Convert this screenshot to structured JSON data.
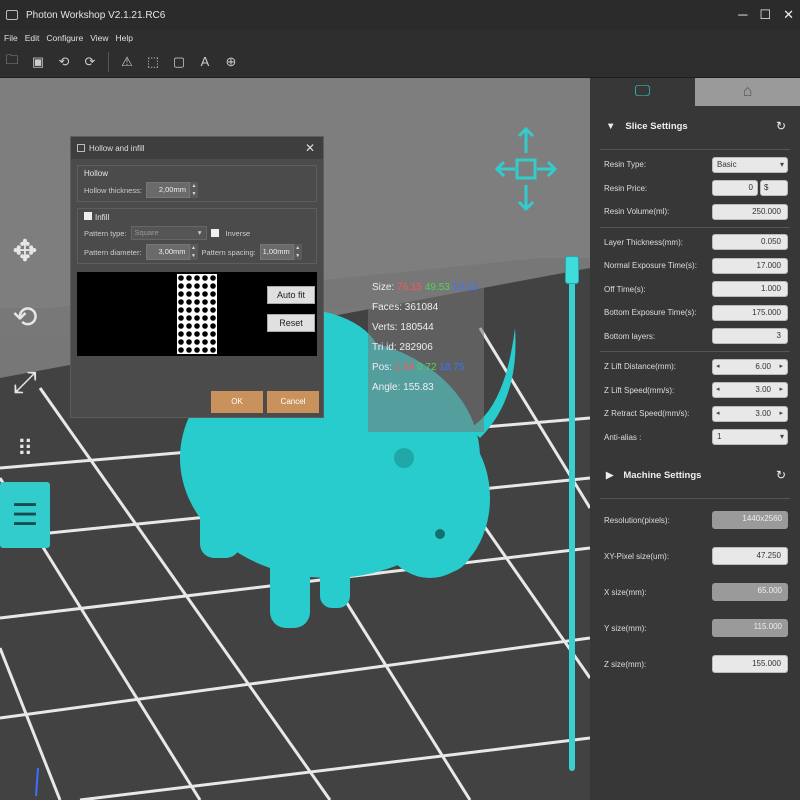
{
  "app": {
    "title": "Photon Workshop V2.1.21.RC6",
    "window_controls": [
      "─",
      "☐",
      "✕"
    ]
  },
  "menu": [
    "File",
    "Edit",
    "Configure",
    "View",
    "Help"
  ],
  "toolbar_icons": [
    "open-file-icon",
    "save-icon",
    "undo-icon",
    "redo-icon",
    "support-icon",
    "hollow-icon",
    "slice-icon",
    "text-icon",
    "globe-icon"
  ],
  "left_tools": [
    "move-icon",
    "rotate-icon",
    "scale-icon",
    "layout-icon",
    "layers-icon"
  ],
  "info": {
    "size_label": "Size:",
    "size_x": "76.15",
    "size_y": "49.53",
    "size_z": "19.53",
    "faces": "Faces: 361084",
    "verts": "Verts: 180544",
    "triid": "Tri id: 282906",
    "pos_label": "Pos:",
    "pos_x": "1.69",
    "pos_y": "0.72",
    "pos_z": "18.75",
    "angle": "Angle: 155.83"
  },
  "dialog": {
    "title": "Hollow and infill",
    "hollow_group": "Hollow",
    "hollow_thickness_label": "Hollow thickness:",
    "hollow_thickness": "2,00mm",
    "infill_group": "Infill",
    "pattern_type_label": "Pattern type:",
    "pattern_type": "Square",
    "inverse_label": "Inverse",
    "pattern_diameter_label": "Pattern diameter:",
    "pattern_diameter": "3,00mm",
    "pattern_spacing_label": "Pattern spacing:",
    "pattern_spacing": "1,00mm",
    "autofit": "Auto fit",
    "reset": "Reset",
    "ok": "OK",
    "cancel": "Cancel"
  },
  "panel": {
    "slice_settings": "Slice Settings",
    "resin_type_label": "Resin Type:",
    "resin_type": "Basic",
    "resin_price_label": "Resin Price:",
    "resin_price": "0",
    "resin_currency": "$",
    "resin_volume_label": "Resin Volume(ml):",
    "resin_volume": "250.000",
    "layer_thickness_label": "Layer Thickness(mm):",
    "layer_thickness": "0.050",
    "normal_exposure_label": "Normal Exposure Time(s):",
    "normal_exposure": "17.000",
    "off_time_label": "Off Time(s):",
    "off_time": "1.000",
    "bottom_exposure_label": "Bottom Exposure Time(s):",
    "bottom_exposure": "175.000",
    "bottom_layers_label": "Bottom layers:",
    "bottom_layers": "3",
    "z_lift_distance_label": "Z Lift Distance(mm):",
    "z_lift_distance": "6.00",
    "z_lift_speed_label": "Z Lift Speed(mm/s):",
    "z_lift_speed": "3.00",
    "z_retract_speed_label": "Z Retract Speed(mm/s):",
    "z_retract_speed": "3.00",
    "anti_alias_label": "Anti-alias :",
    "anti_alias": "1",
    "machine_settings": "Machine Settings",
    "resolution_label": "Resolution(pixels):",
    "resolution": "1440x2560",
    "xy_pixel_label": "XY-Pixel size(um):",
    "xy_pixel": "47.250",
    "x_size_label": "X size(mm):",
    "x_size": "65.000",
    "y_size_label": "Y size(mm):",
    "y_size": "115.000",
    "z_size_label": "Z size(mm):",
    "z_size": "155.000"
  },
  "colors": {
    "accent": "#33cccc",
    "model": "#29cccc",
    "ok_button": "#c9915b"
  },
  "layer_slider_fraction": 0.0
}
